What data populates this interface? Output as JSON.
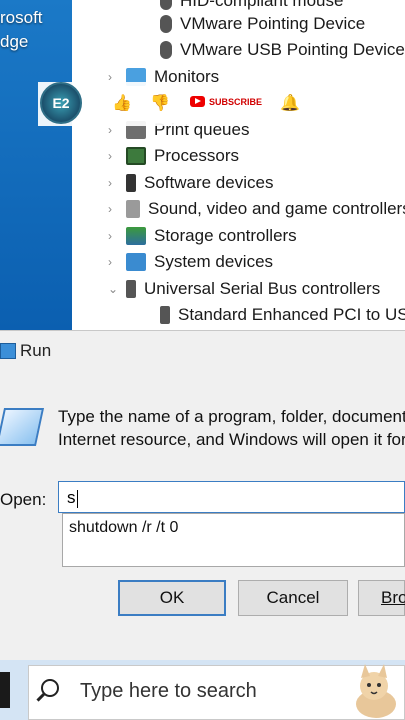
{
  "desktop": {
    "label_line1": "rosoft",
    "label_line2": "dge"
  },
  "device_manager": {
    "items": [
      {
        "label": "HID-compliant mouse",
        "expanded": false
      },
      {
        "label": "VMware Pointing Device",
        "expanded": false
      },
      {
        "label": "VMware USB Pointing Device",
        "expanded": false
      },
      {
        "label": "Monitors",
        "expanded": false
      },
      {
        "label": "Print queues",
        "expanded": false
      },
      {
        "label": "Processors",
        "expanded": false
      },
      {
        "label": "Software devices",
        "expanded": false
      },
      {
        "label": "Sound, video and game controllers",
        "expanded": false
      },
      {
        "label": "Storage controllers",
        "expanded": false
      },
      {
        "label": "System devices",
        "expanded": false
      },
      {
        "label": "Universal Serial Bus controllers",
        "expanded": true
      },
      {
        "label": "Standard Enhanced PCI to USB",
        "expanded": false
      }
    ]
  },
  "overlay": {
    "subscribe_label": "SUBSCRIBE",
    "logo_text": "E2"
  },
  "run_dialog": {
    "title": "Run",
    "description_line1": "Type the name of a program, folder, document",
    "description_line2": "Internet resource, and Windows will open it for",
    "open_label": "Open:",
    "input_value": "s",
    "suggestion": "shutdown /r /t 0",
    "ok_label": "OK",
    "cancel_label": "Cancel",
    "browse_label": "Bro"
  },
  "taskbar": {
    "search_placeholder": "Type here to search"
  }
}
